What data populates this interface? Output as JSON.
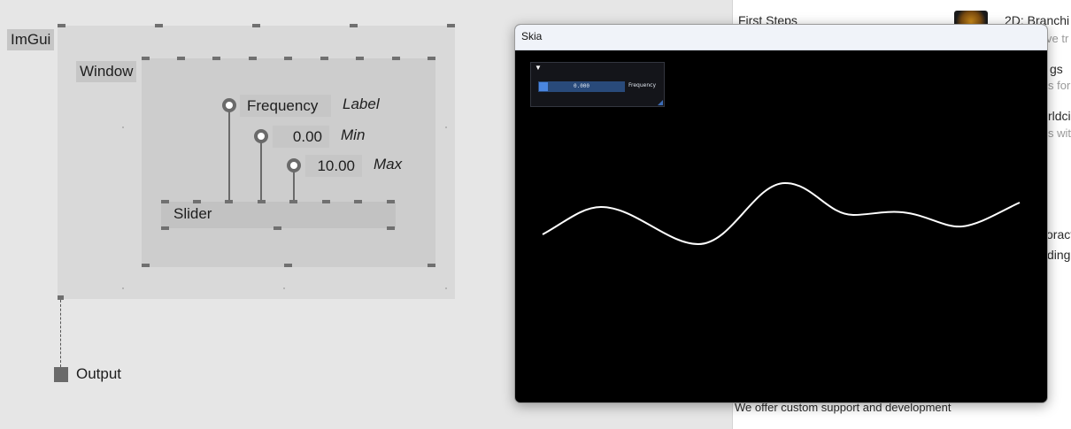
{
  "patch": {
    "imgui_node_label": "ImGui",
    "window_node_label": "Window",
    "frequency_label": "Frequency",
    "label_pin_label": "Label",
    "min_value": "0.00",
    "min_pin_label": "Min",
    "max_value": "10.00",
    "max_pin_label": "Max",
    "slider_node_label": "Slider",
    "output_label": "Output"
  },
  "skia_window": {
    "title": "Skia",
    "imgui_window": {
      "collapse_arrow": "▼",
      "slider_value": "0.000",
      "slider_label": "Frequency",
      "slider_fraction": 0.0,
      "colors": {
        "track": "#294a7a",
        "grab": "#4a86e0",
        "background": "#14151a"
      }
    },
    "canvas": {
      "background": "#000000",
      "stroke": "#ffffff"
    }
  },
  "right_panel": {
    "first_steps": "First Steps",
    "branching_title": "2D: Branchi",
    "sub1": "ve tr",
    "item2": "gs",
    "sub2": "s for",
    "item3": "rldci",
    "sub3": "s wit",
    "item4": "oract",
    "item5": "ding",
    "footer": "We offer custom support and development"
  }
}
